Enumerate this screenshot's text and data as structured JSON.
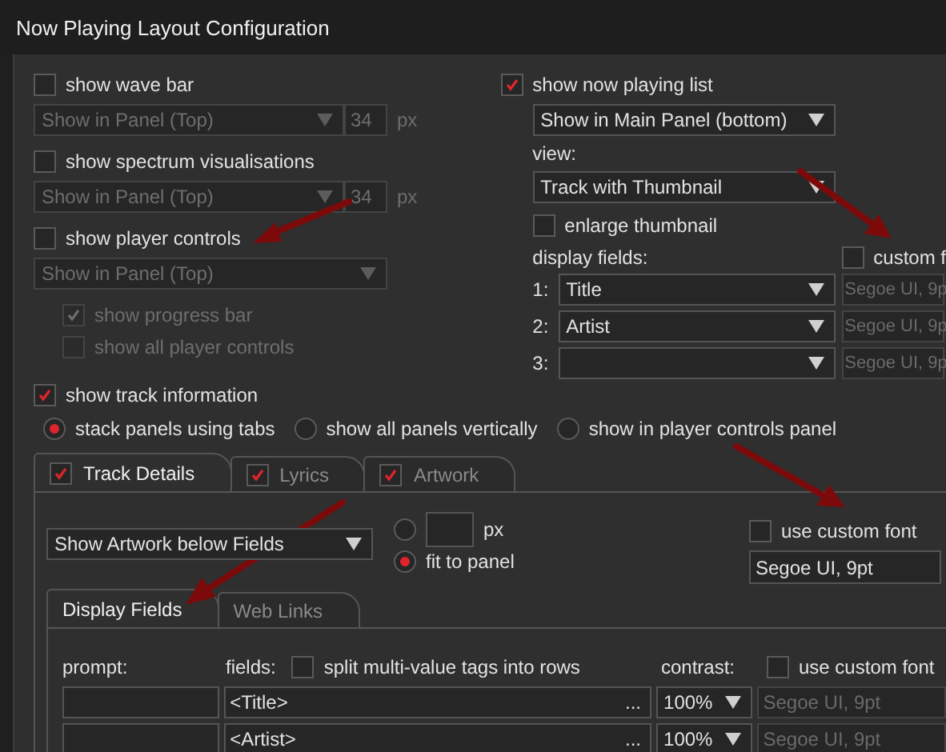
{
  "window": {
    "title": "Now Playing Layout Configuration"
  },
  "wave_bar": {
    "label": "show wave bar",
    "checked": false,
    "position": "Show in Panel (Top)",
    "size": "34",
    "unit": "px",
    "disabled": true
  },
  "spectrum": {
    "label": "show spectrum visualisations",
    "checked": false,
    "position": "Show in Panel (Top)",
    "size": "34",
    "unit": "px",
    "disabled": true
  },
  "player_controls": {
    "label": "show player controls",
    "checked": false,
    "position": "Show in Panel (Top)",
    "disabled": true,
    "options": [
      {
        "label": "show progress bar",
        "checked": true,
        "disabled": true
      },
      {
        "label": "show all player controls",
        "checked": false,
        "disabled": true
      }
    ]
  },
  "now_playing_list": {
    "label": "show now playing list",
    "checked": true,
    "position": "Show in Main Panel (bottom)",
    "view_label": "view:",
    "view": "Track with Thumbnail",
    "enlarge": {
      "label": "enlarge thumbnail",
      "checked": false
    },
    "fields_label": "display fields:",
    "custom_font": {
      "label": "custom f",
      "checked": false
    },
    "fields": [
      {
        "index": "1:",
        "value": "Title",
        "font": "Segoe UI, 9p"
      },
      {
        "index": "2:",
        "value": "Artist",
        "font": "Segoe UI, 9p"
      },
      {
        "index": "3:",
        "font": "Segoe UI, 9p"
      }
    ]
  },
  "track_info": {
    "label": "show track information",
    "checked": true,
    "layouts": [
      {
        "label": "stack panels using tabs",
        "selected": true
      },
      {
        "label": "show all panels vertically",
        "selected": false
      },
      {
        "label": "show in player controls panel",
        "selected": false
      }
    ]
  },
  "tabs": [
    {
      "label": "Track Details",
      "checked": true,
      "selected": true
    },
    {
      "label": "Lyrics",
      "checked": true,
      "selected": false
    },
    {
      "label": "Artwork",
      "checked": true,
      "selected": false
    }
  ],
  "artwork": {
    "position": "Show Artwork below Fields",
    "unit": "px",
    "size_selected": false,
    "fit_label": "fit to panel",
    "fit_selected": true
  },
  "track_font": {
    "label": "use custom font",
    "checked": false,
    "value": "Segoe UI, 9pt"
  },
  "sub_tabs": [
    {
      "label": "Display Fields",
      "selected": true
    },
    {
      "label": "Web Links",
      "selected": false
    }
  ],
  "display_fields": {
    "prompt_label": "prompt:",
    "fields_label": "fields:",
    "split": {
      "label": "split multi-value tags into rows",
      "checked": false
    },
    "contrast_label": "contrast:",
    "font": {
      "label": "use custom font",
      "checked": false
    },
    "rows": [
      {
        "field": "<Title>",
        "more": "...",
        "contrast": "100%",
        "font": "Segoe UI, 9pt"
      },
      {
        "field": "<Artist>",
        "more": "...",
        "contrast": "100%",
        "font": "Segoe UI, 9pt"
      }
    ]
  }
}
